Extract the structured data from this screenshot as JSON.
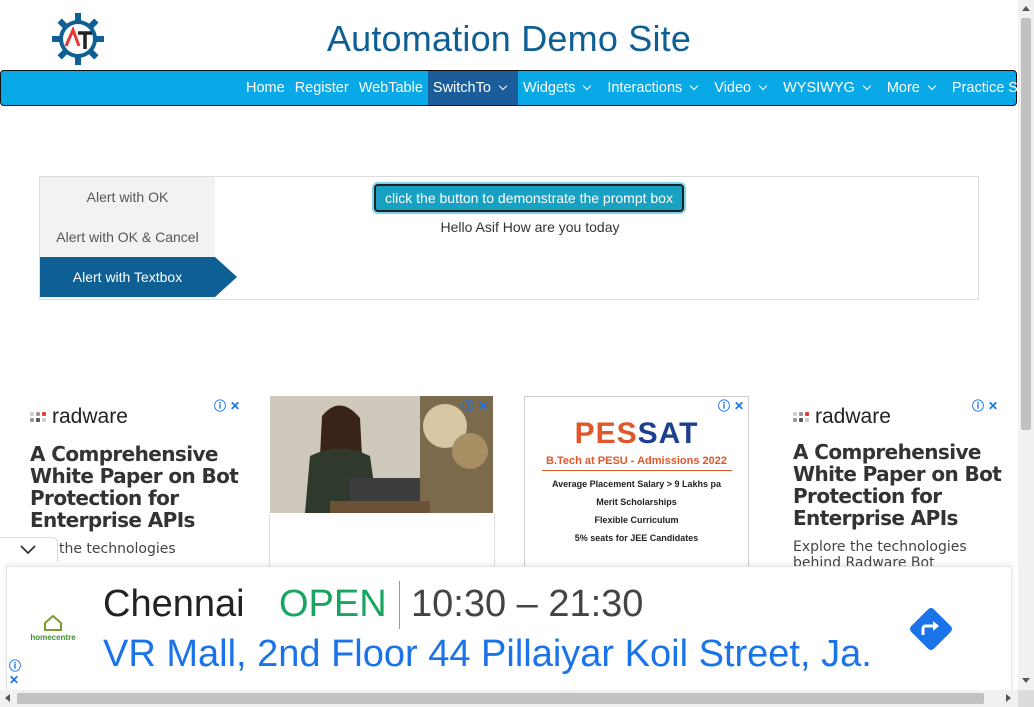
{
  "header": {
    "title": "Automation Demo Site",
    "logo_icon": "gear-logo-icon"
  },
  "nav": {
    "items": [
      {
        "label": "Home",
        "dropdown": false,
        "active": false
      },
      {
        "label": "Register",
        "dropdown": false,
        "active": false
      },
      {
        "label": "WebTable",
        "dropdown": false,
        "active": false
      },
      {
        "label": "SwitchTo",
        "dropdown": true,
        "active": true
      },
      {
        "label": "Widgets",
        "dropdown": true,
        "active": false
      },
      {
        "label": "Interactions",
        "dropdown": true,
        "active": false
      },
      {
        "label": "Video",
        "dropdown": true,
        "active": false
      },
      {
        "label": "WYSIWYG",
        "dropdown": true,
        "active": false
      },
      {
        "label": "More",
        "dropdown": true,
        "active": false
      },
      {
        "label": "Practice Site",
        "dropdown": false,
        "active": false
      }
    ]
  },
  "alerts": {
    "tabs": [
      {
        "label": "Alert with OK",
        "active": false
      },
      {
        "label": "Alert with OK & Cancel",
        "active": false
      },
      {
        "label": "Alert with Textbox",
        "active": true
      }
    ],
    "button_label": "click the button to demonstrate the prompt box",
    "result_text": "Hello Asif How are you today"
  },
  "ads": {
    "radware_brand": "radware",
    "radware_headline": "A Comprehensive White Paper on Bot Protection for Enterprise APIs",
    "radware_sub_left": "lore the technologies",
    "radware_sub_right": "Explore the technologies",
    "radware_sub_right_2": "behind Radware Bot",
    "pessat": {
      "title_part1": "PES",
      "title_part2": "SAT",
      "subtitle": "B.Tech at PESU - Admissions 2022",
      "lines": [
        "Average Placement Salary > 9 Lakhs pa",
        "Merit Scholarships",
        "Flexible Curriculum",
        "5% seats for JEE Candidates"
      ]
    }
  },
  "banner": {
    "brand": "homecentre",
    "city": "Chennai",
    "status": "OPEN",
    "hours": "10:30 – 21:30",
    "address": "VR Mall, 2nd Floor 44 Pillaiyar Koil Street, Ja."
  },
  "colors": {
    "nav_bg": "#09a9e8",
    "brand_blue": "#0e5f94",
    "button_bg": "#17a2c3",
    "open_green": "#1aa462",
    "link_blue": "#1a73e8"
  }
}
